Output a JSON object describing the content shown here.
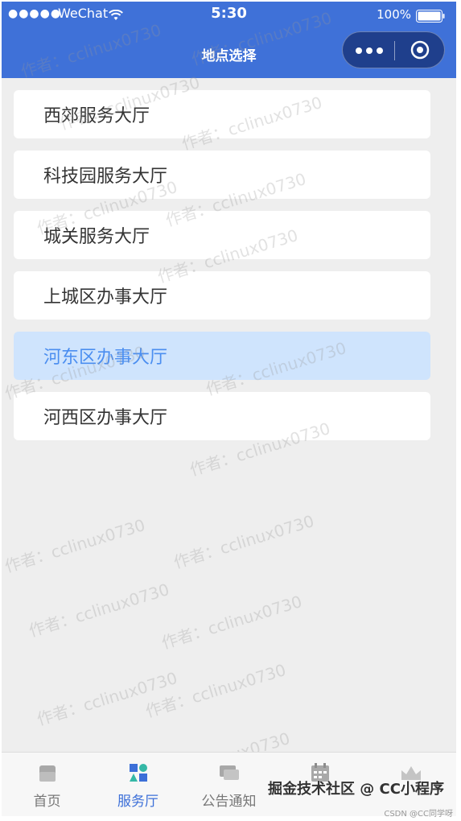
{
  "status_bar": {
    "signal": "●●●●●",
    "carrier": "WeChat",
    "time": "5:30",
    "battery": "100%"
  },
  "nav": {
    "title": "地点选择"
  },
  "halls": [
    {
      "label": "西郊服务大厅",
      "selected": false
    },
    {
      "label": "科技园服务大厅",
      "selected": false
    },
    {
      "label": "城关服务大厅",
      "selected": false
    },
    {
      "label": "上城区办事大厅",
      "selected": false
    },
    {
      "label": "河东区办事大厅",
      "selected": true
    },
    {
      "label": "河西区办事大厅",
      "selected": false
    }
  ],
  "watermark": "作者：cclinux0730",
  "tabs": [
    {
      "label": "首页",
      "icon": "home-icon",
      "active": false
    },
    {
      "label": "服务厅",
      "icon": "service-hall-icon",
      "active": true
    },
    {
      "label": "公告通知",
      "icon": "chat-icon",
      "active": false
    },
    {
      "label": "",
      "icon": "calendar-icon",
      "active": false
    },
    {
      "label": "",
      "icon": "crown-icon",
      "active": false
    }
  ],
  "footer": {
    "brand": "掘金技术社区 @ CC小程序",
    "credit": "CSDN @CC同学呀"
  },
  "colors": {
    "header": "#3f71d8",
    "selected_bg": "#cfe4fd",
    "selected_text": "#4b8ef0",
    "active_tab": "#3c6fd8"
  }
}
